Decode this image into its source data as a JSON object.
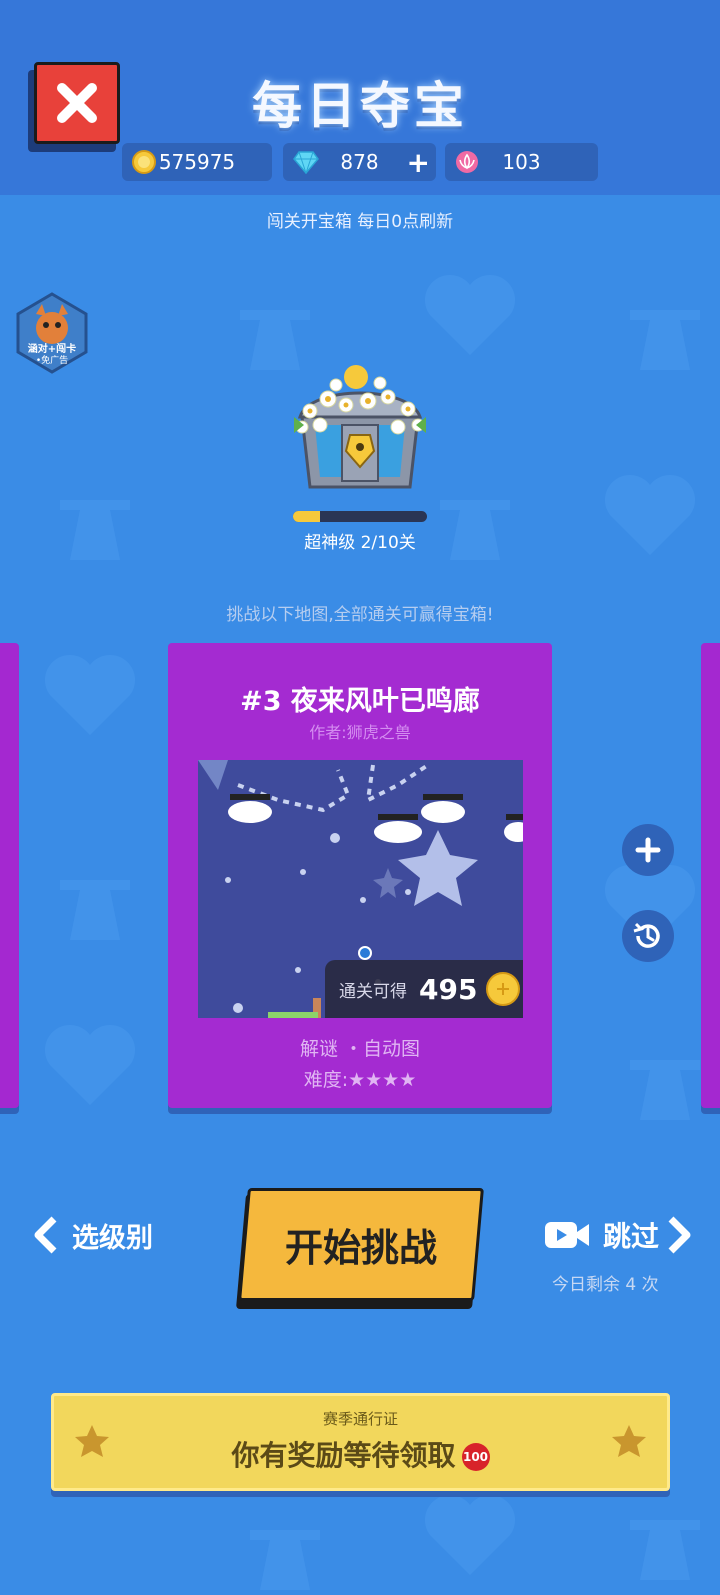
{
  "header": {
    "title": "每日夺宝",
    "coins": "575975",
    "diamonds": "878",
    "diamond_plus": "+",
    "gems": "103",
    "subtitle": "闯关开宝箱 每日0点刷新"
  },
  "side_badge": {
    "line1": "涵对+闯卡",
    "line2": "•免广告"
  },
  "chest": {
    "progress": 0.2,
    "level_text": "超神级 2/10关"
  },
  "challenge_hint": "挑战以下地图,全部通关可赢得宝箱!",
  "map_card": {
    "title": "#3 夜来风叶已鸣廊",
    "author": "作者:狮虎之兽",
    "reward_label": "通关可得",
    "reward_value": "495",
    "tags": "解谜 ・自动图",
    "difficulty": "难度:★★★★"
  },
  "controls": {
    "back_label": "选级别",
    "start_label": "开始挑战",
    "skip_label": "跳过",
    "remaining": "今日剩余 4 次"
  },
  "season_pass": {
    "subtitle": "赛季通行证",
    "message": "你有奖励等待领取",
    "badge": "100"
  },
  "colors": {
    "background": "#3a8ce6",
    "card": "#a42bd1",
    "start_button": "#f5b83d",
    "pass": "#f2d75c",
    "close": "#e8413a"
  }
}
